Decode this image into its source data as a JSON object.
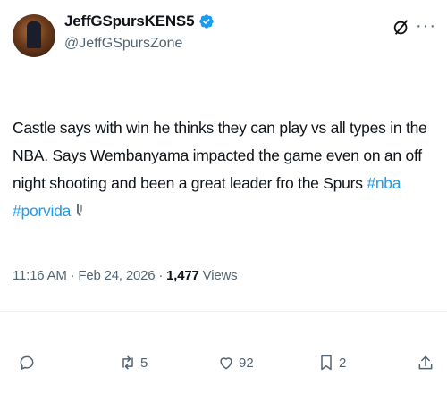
{
  "author": {
    "display_name": "JeffGSpursKENS5",
    "handle": "@JeffGSpursZone",
    "verified": true
  },
  "tweet": {
    "text": "Castle says with win he thinks they can play vs all types in the NBA. Says Wembanyama impacted the game even on an off night shooting and been a great leader fro the Spurs ",
    "hashtags": [
      "#nba",
      "#porvida"
    ]
  },
  "meta": {
    "time": "11:16 AM",
    "date": "Feb 24, 2026",
    "views_count": "1,477",
    "views_label": "Views"
  },
  "actions": {
    "reply": "",
    "retweets": "5",
    "likes": "92",
    "bookmarks": "2"
  },
  "icons": [
    "avatar",
    "verified-icon",
    "grok-icon",
    "more-icon",
    "spurs-emoji-icon",
    "reply-icon",
    "retweet-icon",
    "like-icon",
    "bookmark-icon",
    "share-icon"
  ],
  "colors": {
    "text": "#0f1419",
    "secondary": "#536471",
    "link": "#1d9bf0",
    "verified": "#1d9bf0"
  }
}
